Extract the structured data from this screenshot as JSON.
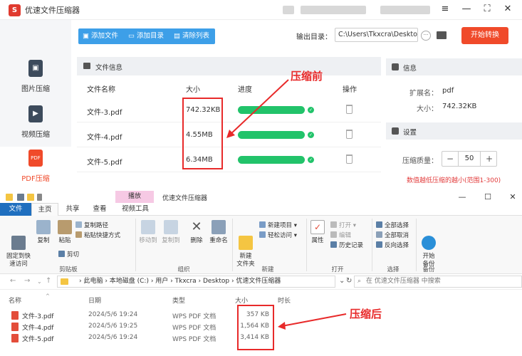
{
  "app": {
    "title": "优速文件压缩器",
    "logo_text": "S",
    "window_buttons": [
      "≡",
      "—",
      "⛶",
      "✕"
    ]
  },
  "nav": [
    {
      "label": "图片压缩",
      "icon": "image-icon",
      "glyph": "▣"
    },
    {
      "label": "视频压缩",
      "icon": "video-icon",
      "glyph": "▶"
    },
    {
      "label": "PDF压缩",
      "icon": "pdf-icon",
      "glyph": "PDF"
    }
  ],
  "toolbar": {
    "add_file": "添加文件",
    "add_folder": "添加目录",
    "clear_list": "清除列表",
    "output_label": "输出目录：",
    "output_path": "C:\\Users\\Tkxcra\\Deskto",
    "browse": "···",
    "start": "开始转换"
  },
  "file_panel": {
    "title": "文件信息",
    "headers": {
      "name": "文件名称",
      "size": "大小",
      "progress": "进度",
      "action": "操作"
    },
    "rows": [
      {
        "name": "文件-3.pdf",
        "size": "742.32KB",
        "progress": 1.0
      },
      {
        "name": "文件-4.pdf",
        "size": "4.55MB",
        "progress": 1.0
      },
      {
        "name": "文件-5.pdf",
        "size": "6.34MB",
        "progress": 1.0
      }
    ]
  },
  "info_panel": {
    "title": "信息",
    "ext_label": "扩展名：",
    "ext_value": "pdf",
    "size_label": "大小：",
    "size_value": "742.32KB"
  },
  "settings_panel": {
    "title": "设置",
    "quality_label": "压缩质量：",
    "minus": "−",
    "quality_value": "50",
    "plus": "+",
    "hint": "数值越低压缩的越小(范围1-300)"
  },
  "annotations": {
    "before": "压缩前",
    "after": "压缩后",
    "color": "#e82a2a"
  },
  "explorer": {
    "context_tab": "播放",
    "title": "优速文件压缩器",
    "window_buttons": [
      "—",
      "☐",
      "✕"
    ],
    "tabs": [
      "文件",
      "主页",
      "共享",
      "查看",
      "视频工具"
    ],
    "ribbon": {
      "pin": "固定到快\n速访问",
      "copy": "复制",
      "paste": "粘贴",
      "copy_path": "复制路径",
      "paste_shortcut": "粘贴快捷方式",
      "cut": "剪切",
      "clipboard_group": "剪贴板",
      "move_to": "移动到",
      "copy_to": "复制到",
      "delete": "删除",
      "rename": "重命名",
      "organize_group": "组织",
      "new_folder": "新建\n文件夹",
      "new_item": "新建项目",
      "easy_access": "轻松访问",
      "new_group": "新建",
      "properties": "属性",
      "open": "打开",
      "edit": "编辑",
      "history": "历史记录",
      "open_group": "打开",
      "select_all": "全部选择",
      "select_none": "全部取消",
      "invert": "反向选择",
      "select_group": "选择",
      "backup": "开始\n备份",
      "backup_group": "备份"
    },
    "address": {
      "crumbs": "›  此电脑  ›  本地磁盘 (C:)  ›  用户  ›  Tkxcra  ›  Desktop  ›  优速文件压缩器",
      "dropdown": "⌄",
      "refresh": "↻",
      "search_placeholder": "在 优速文件压缩器 中搜索"
    },
    "columns": {
      "name": "名称",
      "date": "日期",
      "type": "类型",
      "size": "大小",
      "duration": "时长"
    },
    "files": [
      {
        "name": "文件-3.pdf",
        "date": "2024/5/6 19:24",
        "type": "WPS PDF 文档",
        "size": "357 KB"
      },
      {
        "name": "文件-4.pdf",
        "date": "2024/5/6 19:25",
        "type": "WPS PDF 文档",
        "size": "1,564 KB"
      },
      {
        "name": "文件-5.pdf",
        "date": "2024/5/6 19:24",
        "type": "WPS PDF 文档",
        "size": "3,414 KB"
      }
    ]
  }
}
